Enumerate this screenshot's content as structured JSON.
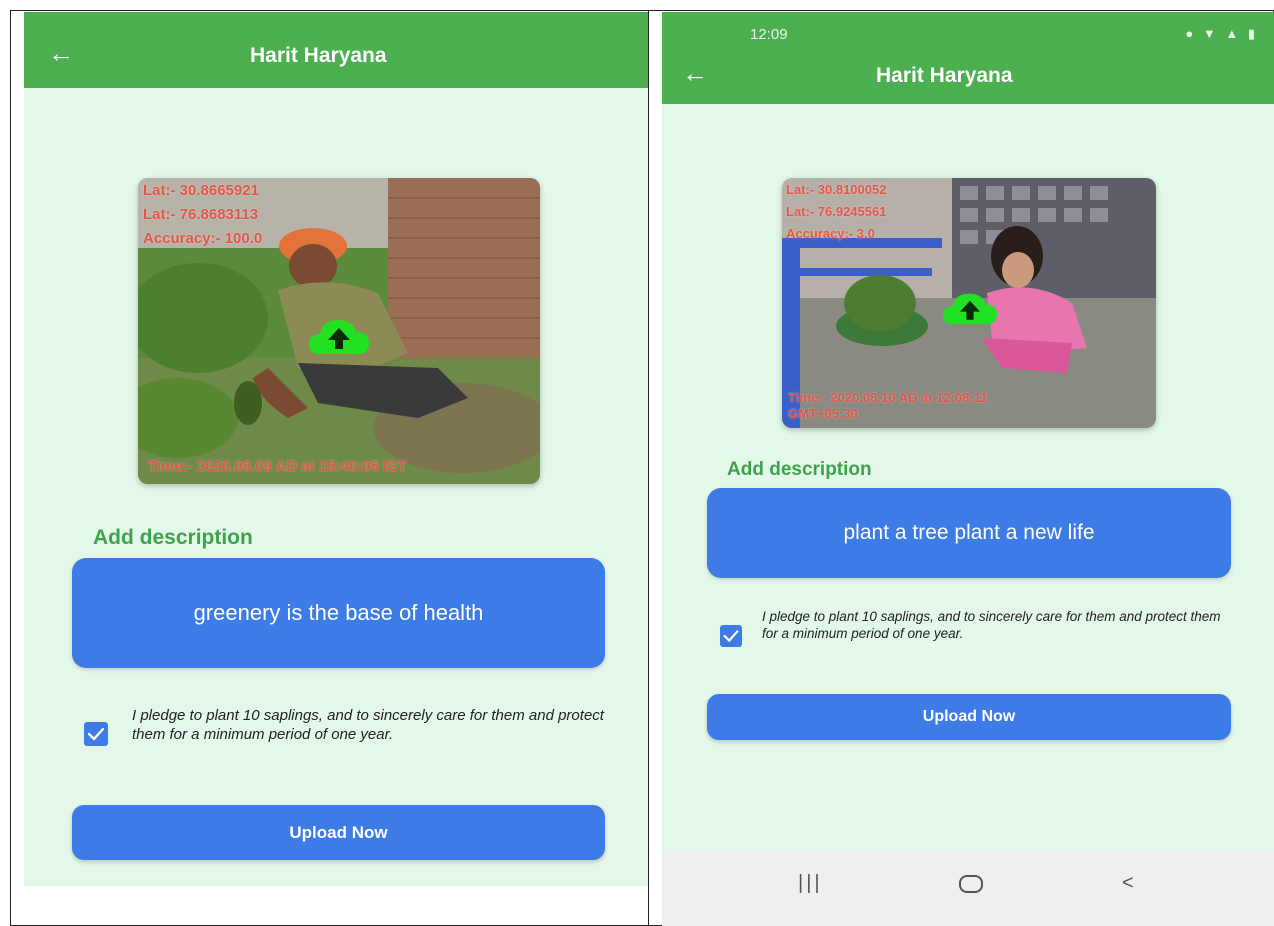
{
  "left_screen": {
    "app_title": "Harit Haryana",
    "back_icon": "arrow-left-icon",
    "photo": {
      "lat_line": "Lat:- 30.8665921",
      "lng_line": "Lat:- 76.8683113",
      "accuracy_line": "Accuracy:- 100.0",
      "time_line": "Time:- 2020.08.09 AD at 15:40:05 IST",
      "upload_icon": "cloud-upload-icon"
    },
    "description_label": "Add description",
    "description_value": "greenery is the base of health",
    "pledge_checked": true,
    "pledge_text": "I pledge to plant 10 saplings, and to sincerely care for them and protect them for a minimum period of one year.",
    "upload_button": "Upload Now"
  },
  "right_screen": {
    "status_time": "12:09",
    "app_title": "Harit Haryana",
    "back_icon": "arrow-left-icon",
    "photo": {
      "lat_line": "Lat:- 30.8100052",
      "lng_line": "Lat:- 76.9245561",
      "accuracy_line": "Accuracy:- 3.0",
      "time_line": "Time:- 2020.08.10 AD at 12:08:11",
      "tz_line": "GMT+05:30",
      "upload_icon": "cloud-upload-icon"
    },
    "description_label": "Add description",
    "description_value": "plant a tree plant a new life",
    "pledge_checked": true,
    "pledge_text": "I pledge to plant 10 saplings, and to sincerely care for them and protect them for a minimum period of one year.",
    "upload_button": "Upload Now",
    "navbar": [
      "recent-apps-icon",
      "home-icon",
      "back-icon"
    ]
  },
  "colors": {
    "appbar": "#4caf50",
    "background": "#e4f8ea",
    "primary_blue": "#3d7be6",
    "label_green": "#3fa34d",
    "overlay_red": "#e2574c"
  }
}
